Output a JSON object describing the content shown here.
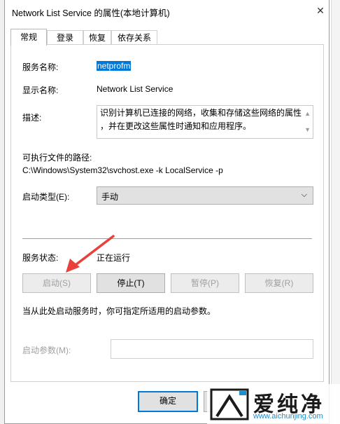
{
  "window": {
    "title": "Network List Service 的属性(本地计算机)",
    "close_glyph": "✕"
  },
  "tabs": [
    {
      "label": "常规",
      "active": true
    },
    {
      "label": "登录",
      "active": false
    },
    {
      "label": "恢复",
      "active": false
    },
    {
      "label": "依存关系",
      "active": false
    }
  ],
  "general": {
    "service_name_label": "服务名称:",
    "service_name_value": "netprofm",
    "display_name_label": "显示名称:",
    "display_name_value": "Network List Service",
    "description_label": "描述:",
    "description_line1": "识别计算机已连接的网络，收集和存储这些网络的属性",
    "description_line2": "，并在更改这些属性时通知和应用程序。",
    "exe_path_label": "可执行文件的路径:",
    "exe_path_value": "C:\\Windows\\System32\\svchost.exe -k LocalService -p",
    "startup_type_label": "启动类型(E):",
    "startup_type_value": "手动",
    "service_status_label": "服务状态:",
    "service_status_value": "正在运行",
    "start_button": "启动(S)",
    "stop_button": "停止(T)",
    "pause_button": "暂停(P)",
    "resume_button": "恢复(R)",
    "hint_text": "当从此处启动服务时，你可指定所适用的启动参数。",
    "start_params_label": "启动参数(M):",
    "start_params_value": ""
  },
  "footer": {
    "ok_button": "确定"
  },
  "watermark": {
    "brand": "爱纯净",
    "url": "www.aichunjing.com"
  },
  "colors": {
    "accent": "#0078d7",
    "arrow": "#e8403a"
  }
}
